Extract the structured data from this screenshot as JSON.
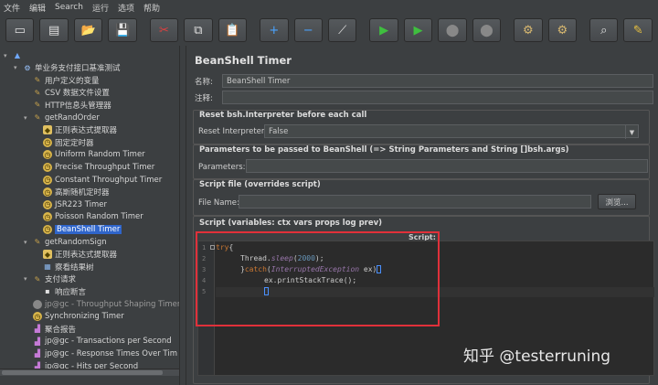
{
  "menu": [
    "文件",
    "编辑",
    "Search",
    "运行",
    "选项",
    "帮助"
  ],
  "toolbar": [
    {
      "icon": "new-icon",
      "glyph": "▭"
    },
    {
      "icon": "templates-icon",
      "glyph": "▤"
    },
    {
      "icon": "open-icon",
      "glyph": "📂"
    },
    {
      "icon": "save-icon",
      "glyph": "💾"
    },
    {
      "icon": "cut-icon",
      "glyph": "✂"
    },
    {
      "icon": "copy-icon",
      "glyph": "⧉"
    },
    {
      "icon": "paste-icon",
      "glyph": "📋"
    },
    {
      "icon": "expand-icon",
      "glyph": "+"
    },
    {
      "icon": "collapse-icon",
      "glyph": "−"
    },
    {
      "icon": "toggle-icon",
      "glyph": "⟋"
    },
    {
      "icon": "start-icon",
      "glyph": "▶"
    },
    {
      "icon": "start-no-pause-icon",
      "glyph": "▶"
    },
    {
      "icon": "stop-icon",
      "glyph": "⬤"
    },
    {
      "icon": "shutdown-icon",
      "glyph": "⬤"
    },
    {
      "icon": "clear-icon",
      "glyph": "⚙"
    },
    {
      "icon": "clear-all-icon",
      "glyph": "⚙"
    },
    {
      "icon": "search-icon",
      "glyph": "⌕"
    },
    {
      "icon": "reset-search-icon",
      "glyph": "✎"
    }
  ],
  "tree": [
    {
      "label": "",
      "indent": 0,
      "icon": "testplan-icon",
      "toggle": "▾"
    },
    {
      "label": "单业务支付接口基准测试",
      "indent": 1,
      "icon": "thread-group-icon",
      "toggle": "▾"
    },
    {
      "label": "用户定义的变量",
      "indent": 2,
      "icon": "config-icon",
      "toggle": ""
    },
    {
      "label": "CSV 数据文件设置",
      "indent": 2,
      "icon": "config-icon",
      "toggle": ""
    },
    {
      "label": "HTTP信息头管理器",
      "indent": 2,
      "icon": "config-icon",
      "toggle": ""
    },
    {
      "label": "getRandOrder",
      "indent": 2,
      "icon": "sampler-icon",
      "toggle": "▾"
    },
    {
      "label": "正则表达式提取器",
      "indent": 3,
      "icon": "script-icon",
      "toggle": ""
    },
    {
      "label": "固定定时器",
      "indent": 3,
      "icon": "timer-icon",
      "toggle": ""
    },
    {
      "label": "Uniform Random Timer",
      "indent": 3,
      "icon": "timer-icon",
      "toggle": ""
    },
    {
      "label": "Precise Throughput Timer",
      "indent": 3,
      "icon": "timer-icon",
      "toggle": ""
    },
    {
      "label": "Constant Throughput Timer",
      "indent": 3,
      "icon": "timer-icon",
      "toggle": ""
    },
    {
      "label": "高斯随机定时器",
      "indent": 3,
      "icon": "timer-icon",
      "toggle": ""
    },
    {
      "label": "JSR223 Timer",
      "indent": 3,
      "icon": "timer-icon",
      "toggle": ""
    },
    {
      "label": "Poisson Random Timer",
      "indent": 3,
      "icon": "timer-icon",
      "toggle": ""
    },
    {
      "label": "BeanShell Timer",
      "indent": 3,
      "icon": "timer-icon",
      "toggle": "",
      "selected": true
    },
    {
      "label": "getRandomSign",
      "indent": 2,
      "icon": "sampler-icon",
      "toggle": "▾"
    },
    {
      "label": "正则表达式提取器",
      "indent": 3,
      "icon": "script-icon",
      "toggle": ""
    },
    {
      "label": "察看结果树",
      "indent": 3,
      "icon": "listener-icon",
      "toggle": ""
    },
    {
      "label": "支付请求",
      "indent": 2,
      "icon": "sampler-icon",
      "toggle": "▾"
    },
    {
      "label": "响应断言",
      "indent": 3,
      "icon": "assertion-icon",
      "toggle": ""
    },
    {
      "label": "jp@gc - Throughput Shaping Timer",
      "indent": 2,
      "icon": "disabled-icon",
      "toggle": ""
    },
    {
      "label": "Synchronizing Timer",
      "indent": 2,
      "icon": "timer-icon",
      "toggle": ""
    },
    {
      "label": "聚合报告",
      "indent": 2,
      "icon": "graph-icon",
      "toggle": ""
    },
    {
      "label": "jp@gc - Transactions per Second",
      "indent": 2,
      "icon": "graph-icon",
      "toggle": ""
    },
    {
      "label": "jp@gc - Response Times Over Tim",
      "indent": 2,
      "icon": "graph-icon",
      "toggle": ""
    },
    {
      "label": "jp@gc - Hits per Second",
      "indent": 2,
      "icon": "graph-icon",
      "toggle": ""
    }
  ],
  "panel": {
    "title": "BeanShell Timer",
    "name_label": "名称:",
    "name_value": "BeanShell Timer",
    "comment_label": "注释:",
    "reset_section": "Reset bsh.Interpreter before each call",
    "reset_label": "Reset Interpreter:",
    "reset_value": "False",
    "params_section": "Parameters to be passed to BeanShell (=> String Parameters and String []bsh.args)",
    "params_label": "Parameters:",
    "file_section": "Script file (overrides script)",
    "file_label": "File Name:",
    "browse_label": "浏览...",
    "script_section": "Script (variables: ctx vars props log prev)",
    "script_label": "Script:"
  },
  "code_lines": [
    "1",
    "2",
    "3",
    "4",
    "5"
  ],
  "code": {
    "l1_kw": "try",
    "l1_rest": "{",
    "l2_call": "Thread.",
    "l2_method": "sleep",
    "l2_open": "(",
    "l2_num": "2000",
    "l2_close": ");",
    "l3_a": "}",
    "l3_kw": "catch",
    "l3_b": "(",
    "l3_type": "InterruptedException",
    "l3_c": " ex)",
    "l4": "ex.printStackTrace();"
  },
  "watermark": "知乎 @testerruning"
}
